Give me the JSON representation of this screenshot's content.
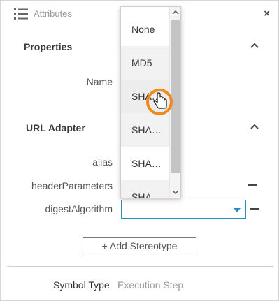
{
  "header": {
    "title": "Attributes",
    "icon": "list-icon"
  },
  "properties": {
    "title": "Properties",
    "name_label": "Name"
  },
  "url_adapter": {
    "title": "URL Adapter",
    "alias_label": "alias",
    "header_parameters_label": "headerParameters",
    "digest_algorithm_label": "digestAlgorithm",
    "digest_algorithm_value": ""
  },
  "dropdown": {
    "options": [
      "None",
      "MD5",
      "SHA…",
      "SHA…",
      "SHA…",
      "SHA…"
    ],
    "hovered_index": 2
  },
  "actions": {
    "add_stereotype_label": "+ Add Stereotype"
  },
  "symbol": {
    "label": "Symbol Type",
    "value": "Execution Step"
  },
  "colors": {
    "accent": "#2a8fbf",
    "cursor_ring": "#f08a1c"
  }
}
